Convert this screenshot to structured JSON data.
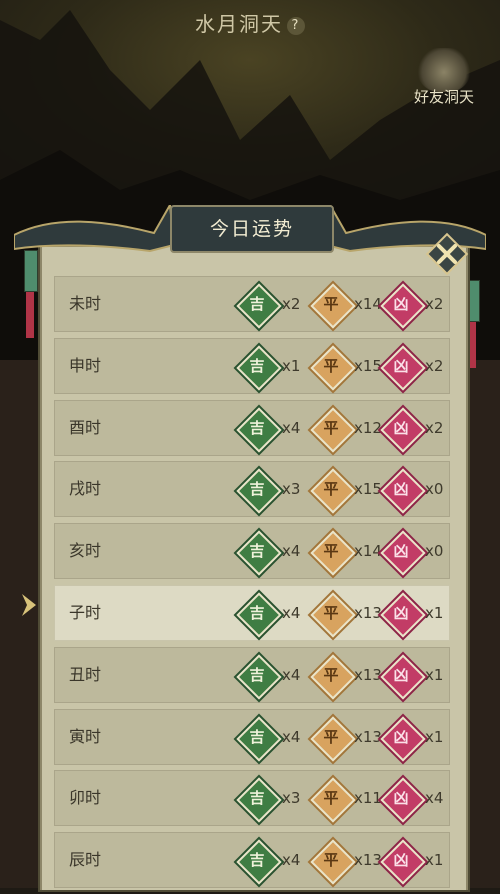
{
  "header": {
    "location": "水月洞天",
    "help_icon": "?",
    "friend_label": "好友洞天"
  },
  "panel": {
    "title": "今日运势",
    "close_icon": "close-icon"
  },
  "badges": {
    "good": "吉",
    "neutral": "平",
    "bad": "凶"
  },
  "rows": [
    {
      "name": "未时",
      "good": "x2",
      "neutral": "x14",
      "bad": "x2"
    },
    {
      "name": "申时",
      "good": "x1",
      "neutral": "x15",
      "bad": "x2"
    },
    {
      "name": "酉时",
      "good": "x4",
      "neutral": "x12",
      "bad": "x2"
    },
    {
      "name": "戌时",
      "good": "x3",
      "neutral": "x15",
      "bad": "x0"
    },
    {
      "name": "亥时",
      "good": "x4",
      "neutral": "x14",
      "bad": "x0"
    },
    {
      "name": "子时",
      "good": "x4",
      "neutral": "x13",
      "bad": "x1",
      "current": true
    },
    {
      "name": "丑时",
      "good": "x4",
      "neutral": "x13",
      "bad": "x1"
    },
    {
      "name": "寅时",
      "good": "x4",
      "neutral": "x13",
      "bad": "x1"
    },
    {
      "name": "卯时",
      "good": "x3",
      "neutral": "x11",
      "bad": "x4"
    },
    {
      "name": "辰时",
      "good": "x4",
      "neutral": "x13",
      "bad": "x1"
    }
  ],
  "colors": {
    "good": "#3f7d43",
    "neutral": "#d8a35f",
    "bad": "#c23c66",
    "panel": "#c9c5a8"
  }
}
